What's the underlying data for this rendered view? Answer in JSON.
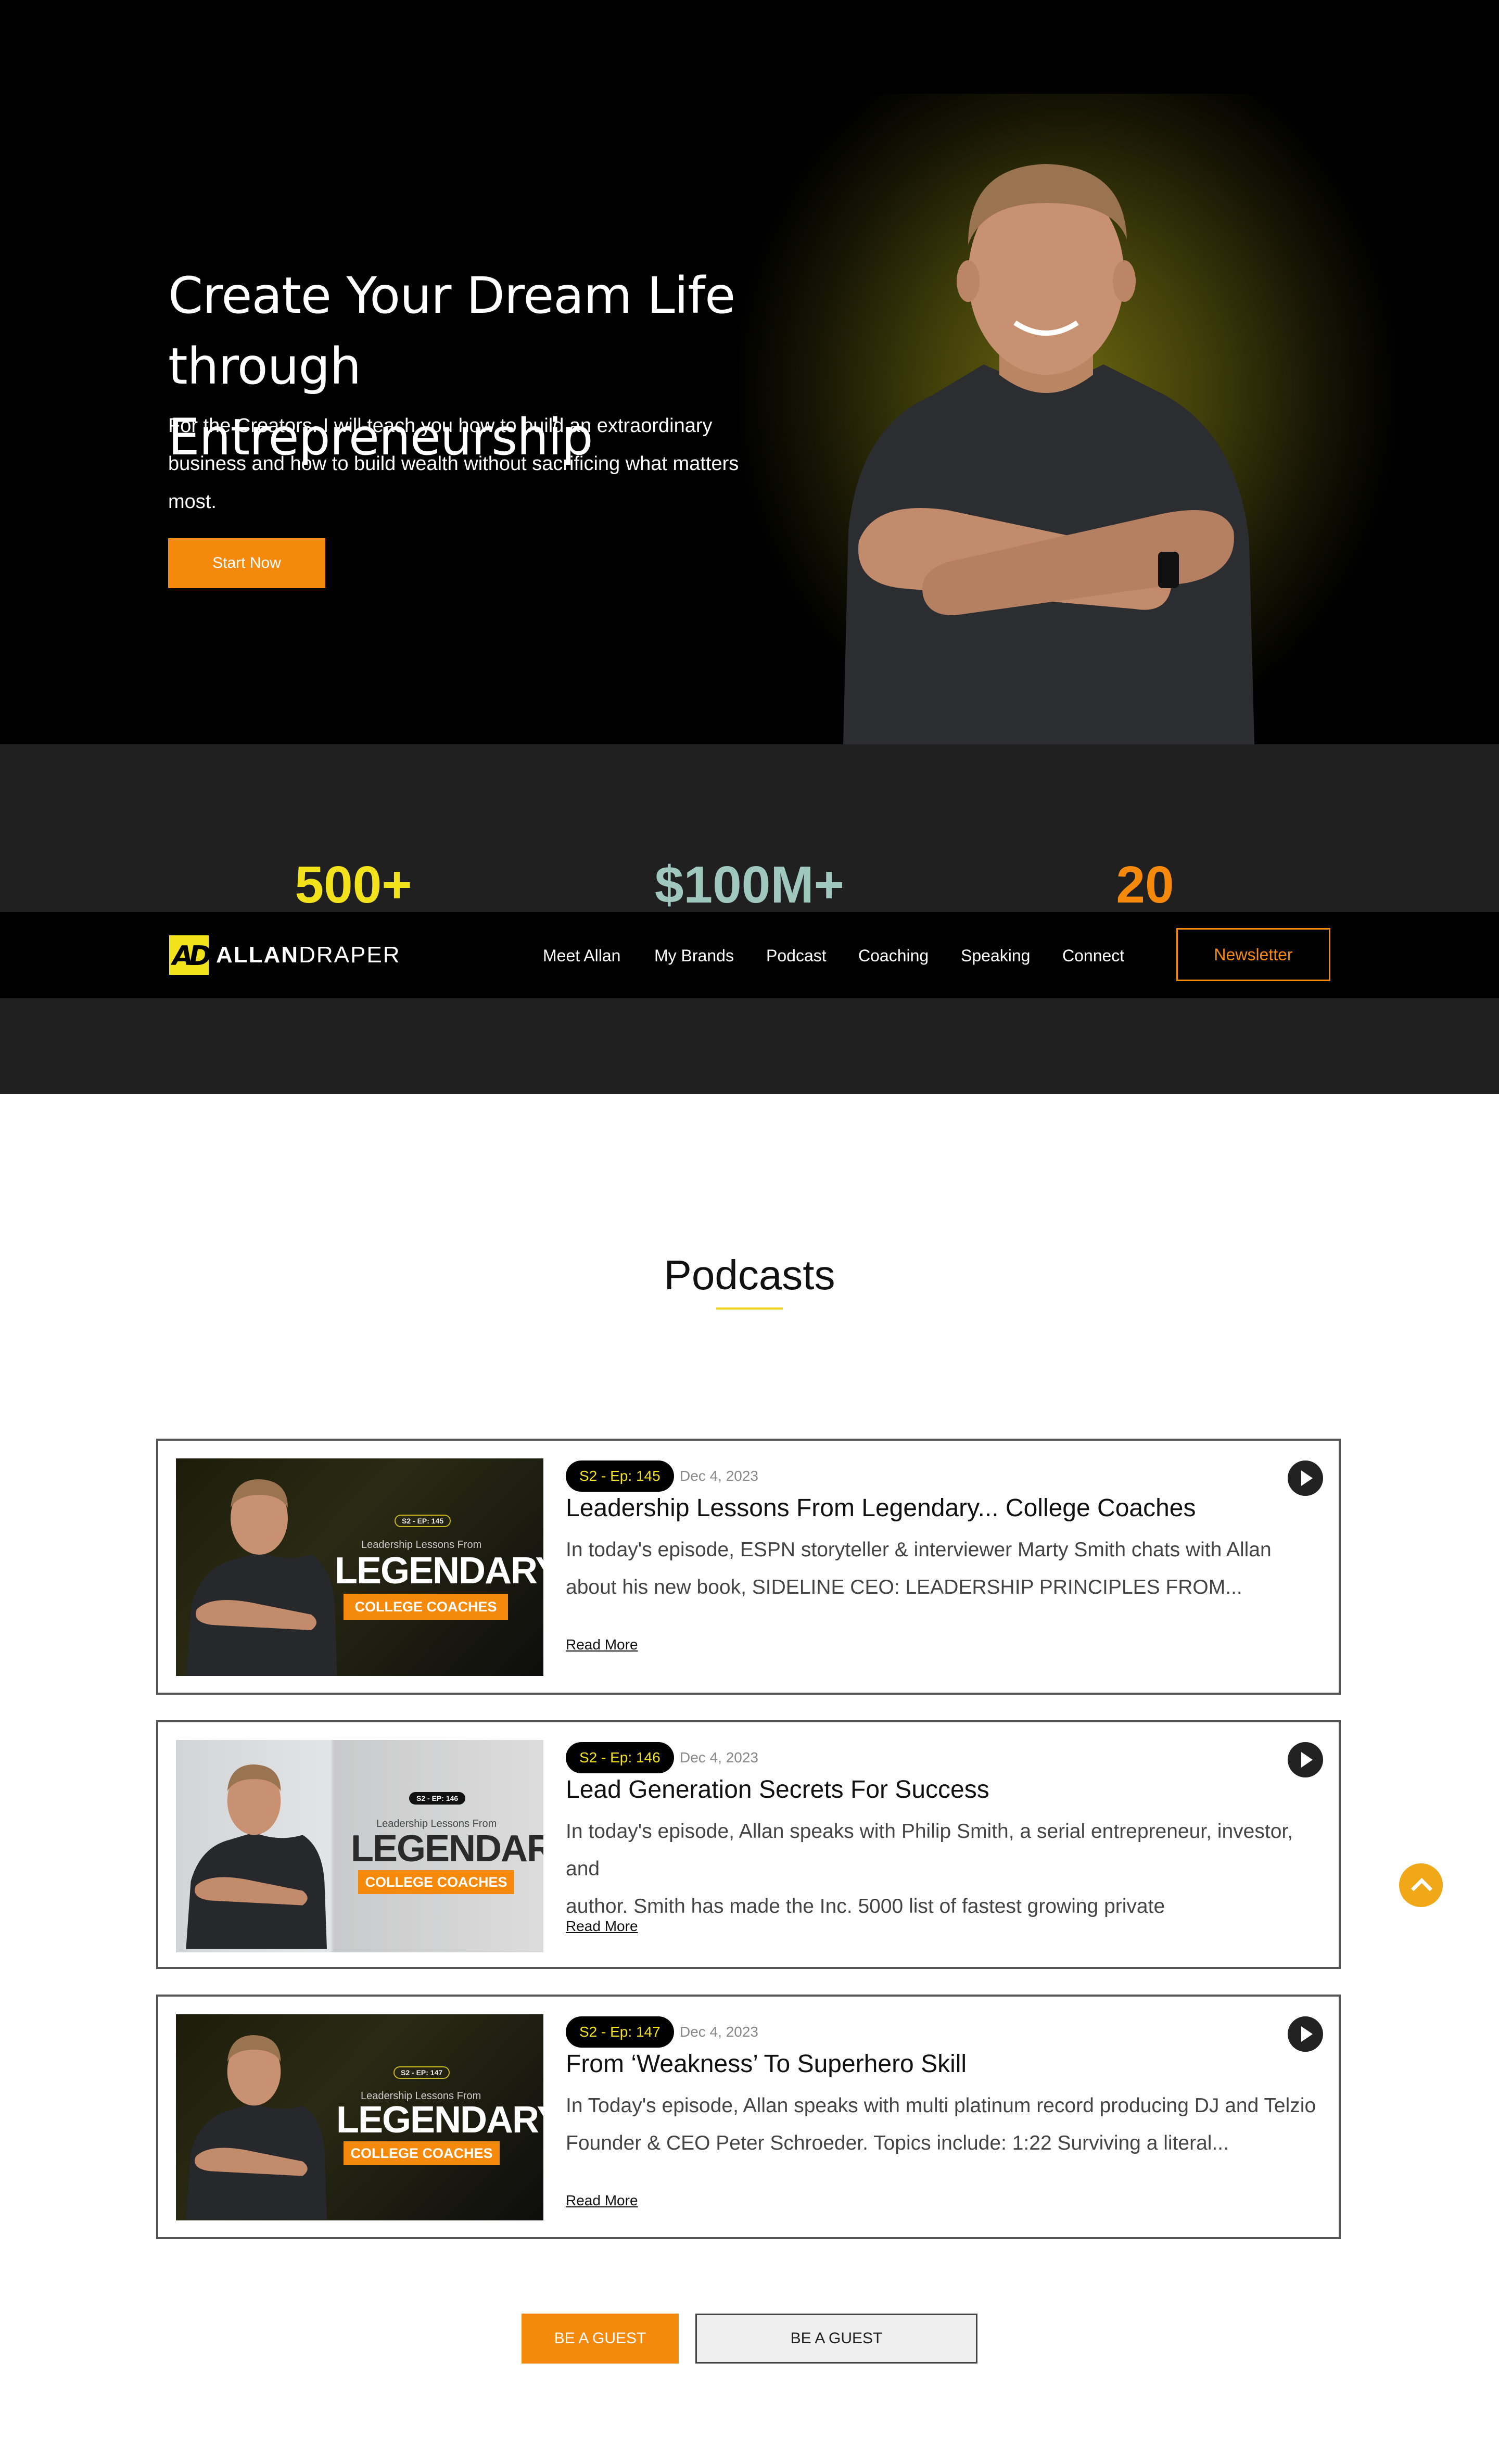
{
  "hero": {
    "title_line1": "Create Your Dream Life",
    "title_line2": "through Entrepreneurship",
    "subtitle": "For the Creators. I will teach you how to build an extraordinary business and how to build wealth without sacrificing what matters most.",
    "cta_label": "Start Now"
  },
  "stats": [
    {
      "value": "500+",
      "color": "#f2e21b"
    },
    {
      "value": "$100M+",
      "color": "#9fc7bd"
    },
    {
      "value": "20",
      "color": "#f5890c"
    }
  ],
  "nav": {
    "logo_mark": "AD",
    "logo_first": "ALLAN",
    "logo_last": "DRAPER",
    "items": [
      "Meet Allan",
      "My Brands",
      "Podcast",
      "Coaching",
      "Speaking",
      "Connect"
    ],
    "newsletter_label": "Newsletter"
  },
  "podcasts": {
    "heading": "Podcasts",
    "episodes": [
      {
        "episode": "S2 - Ep: 145",
        "date": "Dec 4, 2023",
        "title": "Leadership Lessons From Legendary... College Coaches",
        "desc_line1": "In today's episode, ESPN storyteller & interviewer Marty Smith chats with Allan",
        "desc_line2": "about his new book, SIDELINE CEO: LEADERSHIP PRINCIPLES FROM...",
        "read_more": "Read More",
        "thumb": {
          "pill": "S2 - EP: 145",
          "small": "Leadership Lessons From",
          "big": "LEGENDARY",
          "orange": "COLLEGE COACHES",
          "theme": "dark"
        }
      },
      {
        "episode": "S2 - Ep: 146",
        "date": "Dec 4, 2023",
        "title": "Lead Generation Secrets For Success",
        "desc_line1": "In today's episode, Allan speaks with Philip Smith, a serial entrepreneur, investor, and",
        "desc_line2": "author. Smith has made the Inc. 5000 list of fastest growing private",
        "read_more": "Read More",
        "thumb": {
          "pill": "S2 - EP: 146",
          "small": "Leadership Lessons From",
          "big": "LEGENDARY",
          "orange": "COLLEGE COACHES",
          "theme": "light"
        }
      },
      {
        "episode": "S2 - Ep: 147",
        "date": "Dec 4, 2023",
        "title": "From ‘Weakness’ To Superhero Skill",
        "desc_line1": "In Today's episode, Allan speaks with multi platinum record producing DJ and Telzio",
        "desc_line2": "Founder & CEO Peter Schroeder. Topics include: 1:22 Surviving a literal...",
        "read_more": "Read More",
        "thumb": {
          "pill": "S2 - EP: 147",
          "small": "Leadership Lessons From",
          "big": "LEGENDARY",
          "orange": "COLLEGE COACHES",
          "theme": "dark"
        }
      }
    ]
  },
  "guest": {
    "primary_label": "BE A GUEST",
    "secondary_label": "BE A GUEST"
  },
  "colors": {
    "accent_orange": "#f5890c",
    "accent_yellow": "#f2e21b",
    "scroll_top": "#f0a818"
  },
  "icons": {
    "play": "play-icon",
    "scroll_top": "chevron-up-icon"
  }
}
